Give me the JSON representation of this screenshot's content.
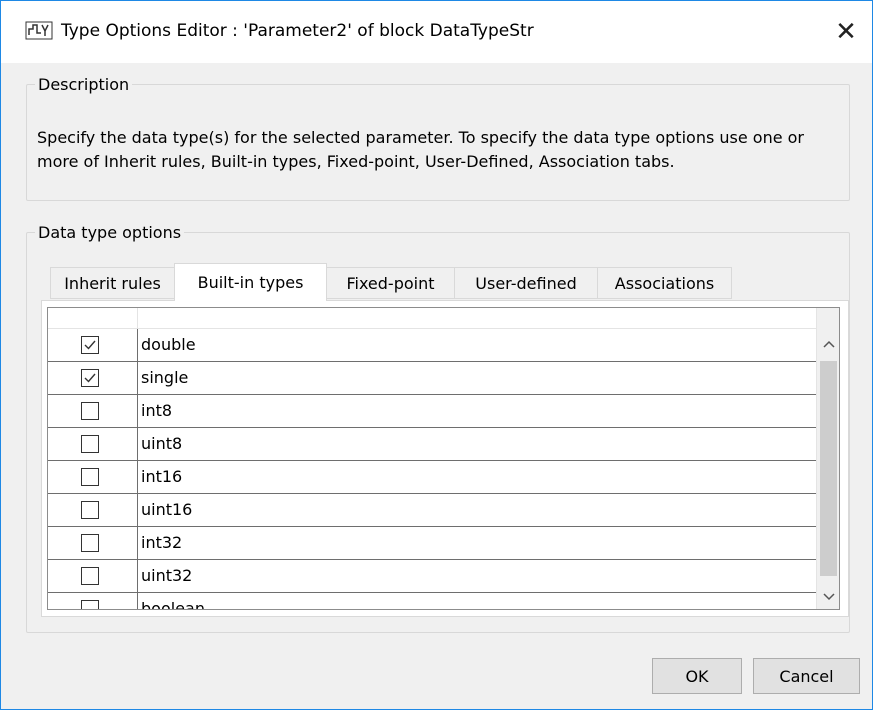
{
  "window": {
    "title": "Type Options Editor : 'Parameter2' of block DataTypeStr",
    "close_symbol": "✕",
    "icon": "simulink-block-icon"
  },
  "description": {
    "legend": "Description",
    "text": "Specify the data type(s) for the selected parameter. To specify the data type options use one or more of Inherit rules, Built-in types, Fixed-point, User-Defined, Association tabs."
  },
  "options": {
    "legend": "Data type options",
    "tabs": [
      {
        "label": "Inherit rules",
        "active": false
      },
      {
        "label": "Built-in types",
        "active": true
      },
      {
        "label": "Fixed-point",
        "active": false
      },
      {
        "label": "User-defined",
        "active": false
      },
      {
        "label": "Associations",
        "active": false
      }
    ],
    "types": [
      {
        "name": "double",
        "checked": true
      },
      {
        "name": "single",
        "checked": true
      },
      {
        "name": "int8",
        "checked": false
      },
      {
        "name": "uint8",
        "checked": false
      },
      {
        "name": "int16",
        "checked": false
      },
      {
        "name": "uint16",
        "checked": false
      },
      {
        "name": "int32",
        "checked": false
      },
      {
        "name": "uint32",
        "checked": false
      },
      {
        "name": "boolean",
        "checked": false
      }
    ]
  },
  "buttons": {
    "ok": "OK",
    "cancel": "Cancel"
  }
}
